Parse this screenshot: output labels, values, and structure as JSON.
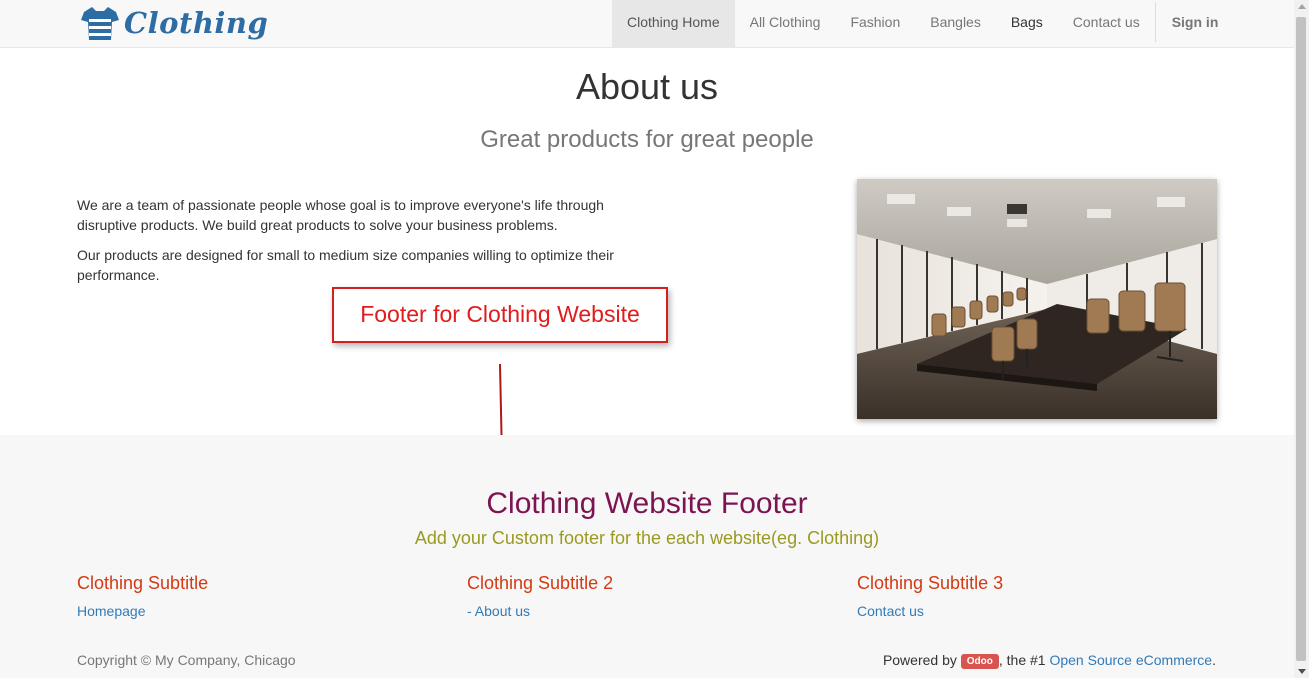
{
  "navbar": {
    "logo_text": "Clothing",
    "items": [
      {
        "label": "Clothing Home"
      },
      {
        "label": "All Clothing"
      },
      {
        "label": "Fashion"
      },
      {
        "label": "Bangles"
      },
      {
        "label": "Bags"
      },
      {
        "label": "Contact us"
      }
    ],
    "signin_label": "Sign in"
  },
  "about": {
    "title": "About us",
    "subtitle": "Great products for great people",
    "paragraphs": [
      "We are a team of passionate people whose goal is to improve everyone's life through disruptive products. We build great products to solve your business problems.",
      "Our products are designed for small to medium size companies willing to optimize their performance."
    ]
  },
  "callout": {
    "label": "Footer for Clothing Website",
    "color": "#e01c1c"
  },
  "footer": {
    "title": "Clothing Website Footer",
    "subtitle": "Add your Custom footer for the each website(eg. Clothing)",
    "columns": [
      {
        "title": "Clothing Subtitle",
        "link": "Homepage"
      },
      {
        "title": "Clothing Subtitle 2",
        "link": "- About us"
      },
      {
        "title": "Clothing Subtitle 3",
        "link": "Contact us"
      }
    ],
    "copyright": "Copyright © My Company, Chicago",
    "powered_prefix": "Powered by",
    "badge": "Odoo",
    "powered_middle": ", the #1",
    "powered_link": "Open Source eCommerce",
    "powered_suffix": "."
  },
  "colors": {
    "brand": "#2e6da4",
    "footer_title": "#7b1450",
    "footer_subtitle": "#9a9a22",
    "column_title": "#d33a14",
    "link": "#337ab7"
  }
}
